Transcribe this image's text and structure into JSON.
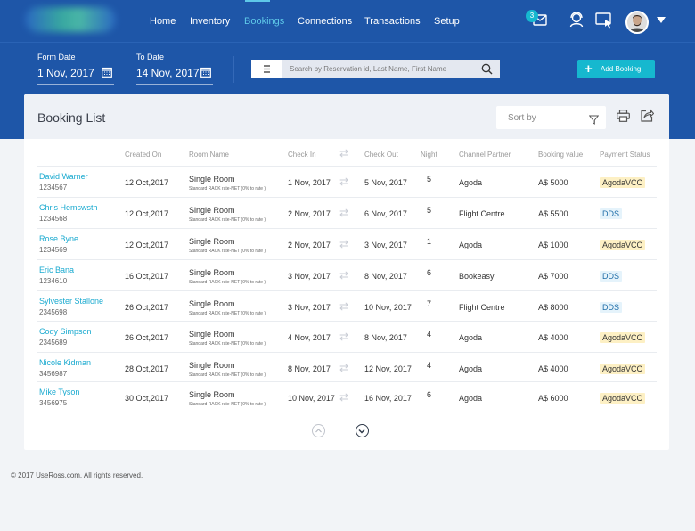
{
  "nav": {
    "items": [
      "Home",
      "Inventory",
      "Bookings",
      "Connections",
      "Transactions",
      "Setup"
    ],
    "active": "Bookings"
  },
  "header": {
    "mail_badge": "3"
  },
  "filters": {
    "form_date_label": "Form Date",
    "form_date_value": "1 Nov, 2017",
    "to_date_label": "To Date",
    "to_date_value": "14 Nov, 2017",
    "search_placeholder": "Search by Reservation id, Last Name, First Name",
    "add_label": "Add Booking"
  },
  "card": {
    "title": "Booking List",
    "sort_label": "Sort by"
  },
  "table": {
    "columns": [
      "Created On",
      "Room Name",
      "Check In",
      "Check Out",
      "Night",
      "Channel Partner",
      "Booking value",
      "Payment Status"
    ],
    "rows": [
      {
        "name": "David Warner",
        "id": "1234567",
        "created": "12 Oct,2017",
        "room": "Single Room",
        "rate": "Standard RACK rate-NET (0% to rate )",
        "checkin": "1 Nov, 2017",
        "checkout": "5 Nov, 2017",
        "night": "5",
        "partner": "Agoda",
        "value": "A$ 5000",
        "status": "AgodaVCC"
      },
      {
        "name": "Chris Hemswsth",
        "id": "1234568",
        "created": "12 Oct,2017",
        "room": "Single Room",
        "rate": "Standard RACK rate-NET (0% to rate )",
        "checkin": "2 Nov, 2017",
        "checkout": "6 Nov, 2017",
        "night": "5",
        "partner": "Flight Centre",
        "value": "A$ 5500",
        "status": "DDS"
      },
      {
        "name": "Rose Byne",
        "id": "1234569",
        "created": "12 Oct,2017",
        "room": "Single Room",
        "rate": "Standard RACK rate-NET (0% to rate )",
        "checkin": "2 Nov, 2017",
        "checkout": "3 Nov, 2017",
        "night": "1",
        "partner": "Agoda",
        "value": "A$ 1000",
        "status": "AgodaVCC"
      },
      {
        "name": "Eric Bana",
        "id": "1234610",
        "created": "16 Oct,2017",
        "room": "Single Room",
        "rate": "Standard RACK rate-NET (0% to rate )",
        "checkin": "3 Nov, 2017",
        "checkout": "8 Nov, 2017",
        "night": "6",
        "partner": "Bookeasy",
        "value": "A$ 7000",
        "status": "DDS"
      },
      {
        "name": "Sylvester Stallone",
        "id": "2345698",
        "created": "26 Oct,2017",
        "room": "Single Room",
        "rate": "Standard RACK rate-NET (0% to rate )",
        "checkin": "3 Nov, 2017",
        "checkout": "10 Nov, 2017",
        "night": "7",
        "partner": "Flight Centre",
        "value": "A$ 8000",
        "status": "DDS"
      },
      {
        "name": "Cody Simpson",
        "id": "2345689",
        "created": "26 Oct,2017",
        "room": "Single Room",
        "rate": "Standard RACK rate-NET (0% to rate )",
        "checkin": "4 Nov, 2017",
        "checkout": "8 Nov, 2017",
        "night": "4",
        "partner": "Agoda",
        "value": "A$ 4000",
        "status": "AgodaVCC"
      },
      {
        "name": "Nicole Kidman",
        "id": "3456987",
        "created": "28 Oct,2017",
        "room": "Single Room",
        "rate": "Standard RACK rate-NET (0% to rate )",
        "checkin": "8 Nov, 2017",
        "checkout": "12 Nov, 2017",
        "night": "4",
        "partner": "Agoda",
        "value": "A$ 4000",
        "status": "AgodaVCC"
      },
      {
        "name": "Mike Tyson",
        "id": "3456975",
        "created": "30 Oct,2017",
        "room": "Single Room",
        "rate": "Standard RACK rate-NET (0% to rate )",
        "checkin": "10 Nov, 2017",
        "checkout": "16 Nov, 2017",
        "night": "6",
        "partner": "Agoda",
        "value": "A$ 6000",
        "status": "AgodaVCC"
      }
    ]
  },
  "footer": {
    "text": "© 2017 UseRoss.com. All rights reserved."
  },
  "colors": {
    "header": "#1e56a8",
    "accent": "#16b8cf",
    "name": "#1aaad0",
    "agoda_pill": "#fdf0c4",
    "dds_pill": "#e5f3fb"
  },
  "icons": [
    "mail-icon",
    "support-icon",
    "screen-cursor-icon",
    "avatar",
    "calendar-icon",
    "menu-icon",
    "search-icon",
    "plus-icon",
    "filter-icon",
    "print-icon",
    "share-icon",
    "swap-arrows-icon",
    "chevron-up-icon",
    "chevron-down-icon"
  ]
}
